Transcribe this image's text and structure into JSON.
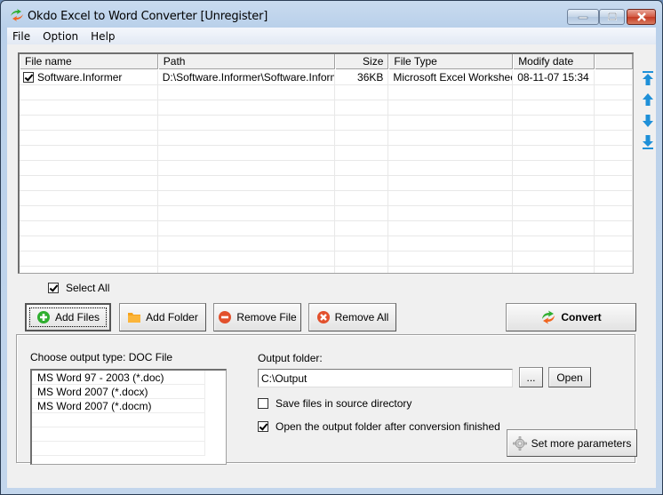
{
  "window": {
    "title": "Okdo Excel to Word Converter [Unregister]",
    "controls": [
      "minimize",
      "maximize",
      "close"
    ]
  },
  "menu": {
    "items": [
      {
        "label": "File"
      },
      {
        "label": "Option"
      },
      {
        "label": "Help"
      }
    ]
  },
  "file_list": {
    "columns": [
      {
        "label": "File name"
      },
      {
        "label": "Path"
      },
      {
        "label": "Size"
      },
      {
        "label": "File Type"
      },
      {
        "label": "Modify date"
      },
      {
        "label": ""
      }
    ],
    "rows": [
      {
        "checked": true,
        "name": "Software.Informer",
        "path": "D:\\Software.Informer\\Software.Inform...",
        "size": "36KB",
        "type": "Microsoft Excel Worksheet",
        "date": "08-11-07 15:34"
      }
    ],
    "side_buttons": [
      {
        "icon": "move-to-top-icon"
      },
      {
        "icon": "move-up-icon"
      },
      {
        "icon": "move-down-icon"
      },
      {
        "icon": "move-to-bottom-icon"
      }
    ]
  },
  "select_all": {
    "label": "Select All",
    "checked": true
  },
  "actions": {
    "add_files": "Add Files",
    "add_folder": "Add Folder",
    "remove_file": "Remove File",
    "remove_all": "Remove All",
    "convert": "Convert"
  },
  "output": {
    "type_label": "Choose output type:  DOC File",
    "types": [
      "MS Word 97 - 2003 (*.doc)",
      "MS Word 2007 (*.docx)",
      "MS Word 2007 (*.docm)"
    ],
    "folder_label": "Output folder:",
    "folder_value": "C:\\Output",
    "browse_label": "...",
    "open_label": "Open",
    "save_in_source": {
      "label": "Save files in source directory",
      "checked": false
    },
    "open_after": {
      "label": "Open the output folder after conversion finished",
      "checked": true
    },
    "params_label": "Set more parameters"
  },
  "colors": {
    "accent_blue": "#1e90d8",
    "close_red": "#c43a24",
    "add_green": "#2fae2f",
    "remove_red": "#e2502c",
    "folder_orange": "#f6a21c"
  }
}
